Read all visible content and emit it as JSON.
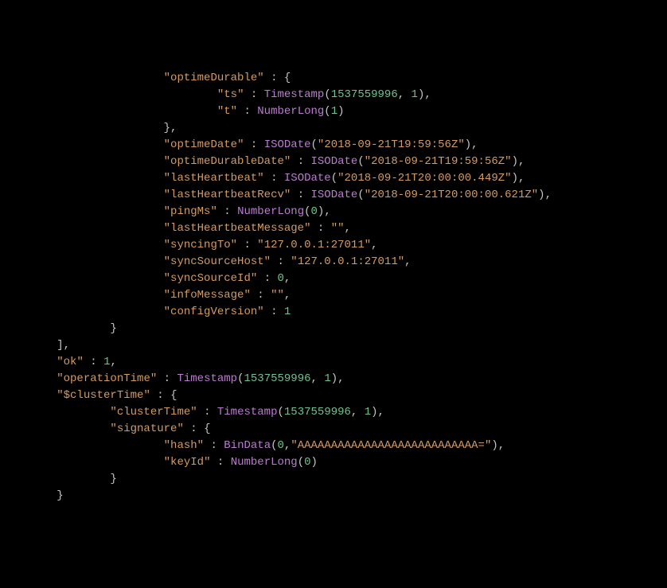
{
  "optimeDurable": {
    "label": "optimeDurable",
    "ts_label": "ts",
    "ts_func": "Timestamp",
    "ts_arg1": "1537559996",
    "ts_arg2": "1",
    "t_label": "t",
    "t_func": "NumberLong",
    "t_arg1": "1"
  },
  "optimeDate": {
    "label": "optimeDate",
    "func": "ISODate",
    "value": "2018-09-21T19:59:56Z"
  },
  "optimeDurableDate": {
    "label": "optimeDurableDate",
    "func": "ISODate",
    "value": "2018-09-21T19:59:56Z"
  },
  "lastHeartbeat": {
    "label": "lastHeartbeat",
    "func": "ISODate",
    "value": "2018-09-21T20:00:00.449Z"
  },
  "lastHeartbeatRecv": {
    "label": "lastHeartbeatRecv",
    "func": "ISODate",
    "value": "2018-09-21T20:00:00.621Z"
  },
  "pingMs": {
    "label": "pingMs",
    "func": "NumberLong",
    "arg": "0"
  },
  "lastHeartbeatMessage": {
    "label": "lastHeartbeatMessage",
    "value": ""
  },
  "syncingTo": {
    "label": "syncingTo",
    "value": "127.0.0.1:27011"
  },
  "syncSourceHost": {
    "label": "syncSourceHost",
    "value": "127.0.0.1:27011"
  },
  "syncSourceId": {
    "label": "syncSourceId",
    "value": "0"
  },
  "infoMessage": {
    "label": "infoMessage",
    "value": ""
  },
  "configVersion": {
    "label": "configVersion",
    "value": "1"
  },
  "ok": {
    "label": "ok",
    "value": "1"
  },
  "operationTime": {
    "label": "operationTime",
    "func": "Timestamp",
    "arg1": "1537559996",
    "arg2": "1"
  },
  "clusterTimeOuter": {
    "label": "$clusterTime"
  },
  "clusterTime": {
    "label": "clusterTime",
    "func": "Timestamp",
    "arg1": "1537559996",
    "arg2": "1"
  },
  "signature": {
    "label": "signature",
    "hash_label": "hash",
    "hash_func": "BinData",
    "hash_arg1": "0",
    "hash_arg2": "AAAAAAAAAAAAAAAAAAAAAAAAAAA=",
    "keyId_label": "keyId",
    "keyId_func": "NumberLong",
    "keyId_arg": "0"
  }
}
